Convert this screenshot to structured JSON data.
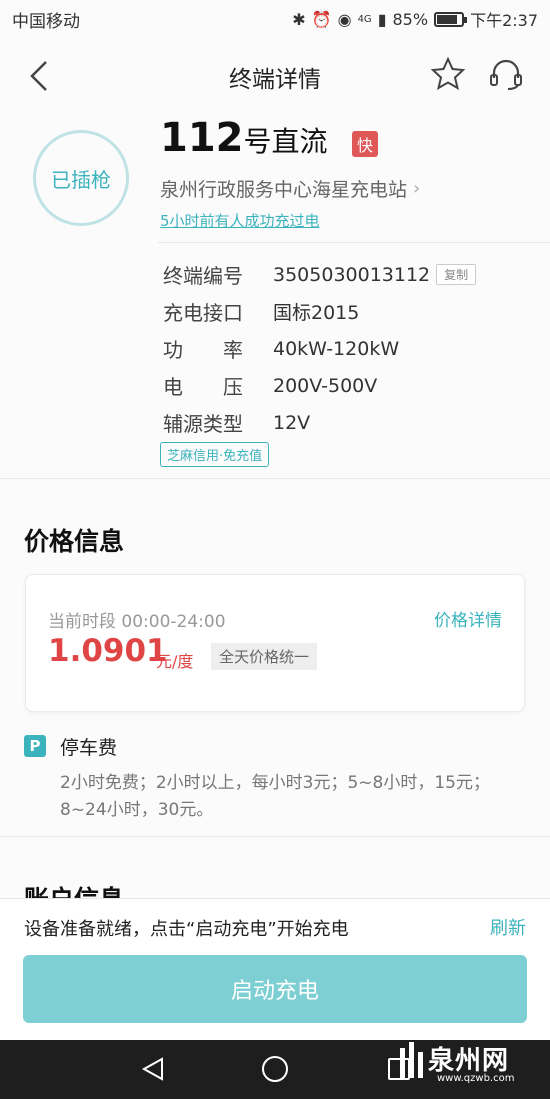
{
  "status_bar": {
    "carrier": "中国移动",
    "network": "4G",
    "battery": "85%",
    "battery_level": 0.85,
    "time": "下午2:37"
  },
  "title_bar": {
    "title": "终端详情",
    "icons": [
      "back-icon",
      "star-icon",
      "headset-icon"
    ]
  },
  "terminal": {
    "plug_status": "已插枪",
    "number": "112",
    "name_suffix": "号直流",
    "speed_badge": "快",
    "station": "泉州行政服务中心海星充电站",
    "recent_success": "5小时前有人成功充过电"
  },
  "info": {
    "code_label": "终端编号",
    "code_value": "3505030013112",
    "copy_label": "复制",
    "port_label": "充电接口",
    "port_value": "国标2015",
    "power_label": "功　　率",
    "power_value": "40kW-120kW",
    "voltage_label": "电　　压",
    "voltage_value": "200V-500V",
    "aux_label": "辅源类型",
    "aux_value": "12V",
    "credit_tag": "芝麻信用·免充值"
  },
  "price": {
    "section_title": "价格信息",
    "period": "当前时段 00:00-24:00",
    "detail_link": "价格详情",
    "value": "1.0901",
    "unit": "元/度",
    "uniform_tag": "全天价格统一"
  },
  "parking": {
    "icon_letter": "P",
    "title": "停车费",
    "description": "2小时免费；2小时以上，每小时3元；5~8小时，15元；8~24小时，30元。"
  },
  "account": {
    "section_title": "账户信息"
  },
  "bottom": {
    "ready_text": "设备准备就绪，点击“启动充电”开始充电",
    "refresh": "刷新",
    "start_button": "启动充电"
  },
  "watermark": {
    "name": "泉州网",
    "url": "www.qzwb.com"
  },
  "colors": {
    "accent": "#3bb3bd",
    "price": "#e04545",
    "badge": "#e05757",
    "button": "#7ecfd3"
  }
}
